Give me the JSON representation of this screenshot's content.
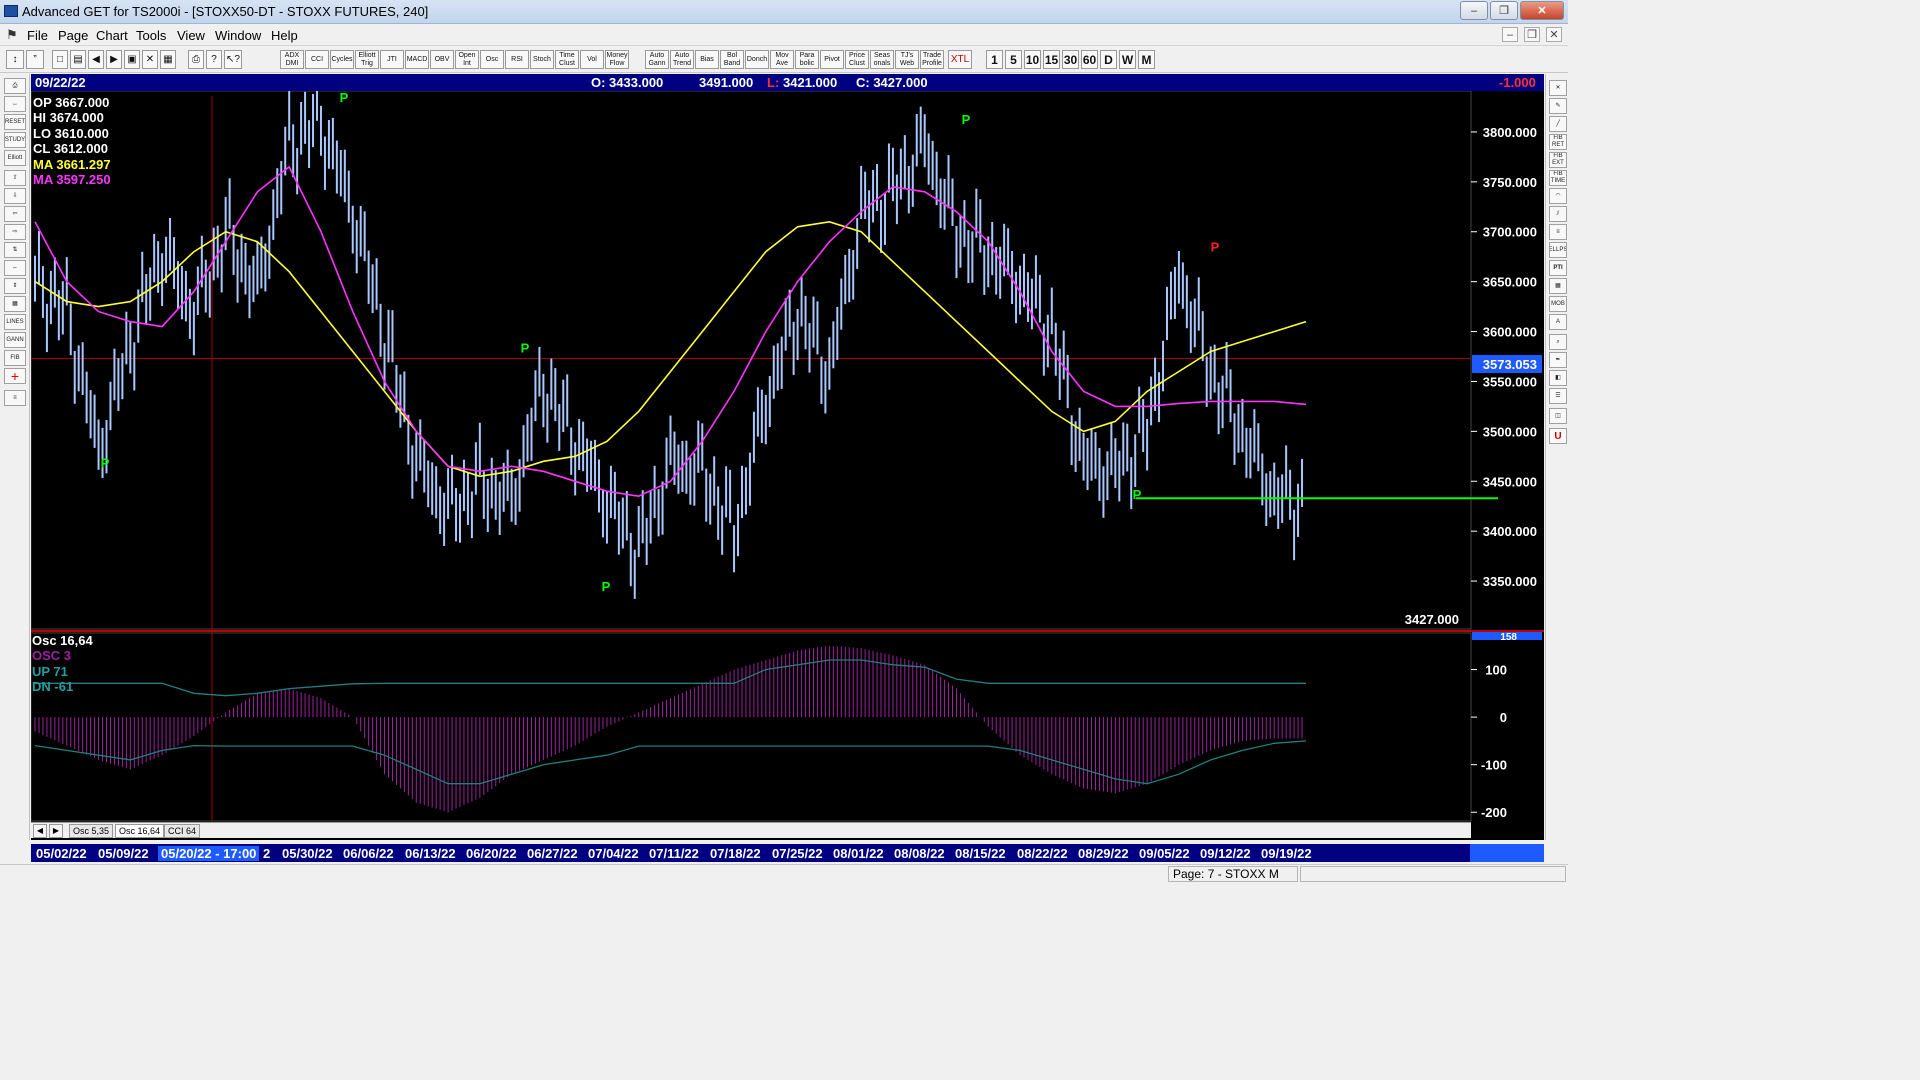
{
  "window": {
    "title": "Advanced GET for TS2000i - [STOXX50-DT - STOXX FUTURES, 240]"
  },
  "menu": [
    "File",
    "Page",
    "Chart",
    "Tools",
    "View",
    "Window",
    "Help"
  ],
  "toolbar": {
    "indicators": [
      "ADX DMI",
      "CCI",
      "Cycles",
      "Elliott Trig",
      "JTI",
      "MACD",
      "OBV",
      "Open Int",
      "Osc",
      "RSI",
      "Stoch",
      "Time Clust",
      "Vol",
      "Money Flow",
      "Auto Gann",
      "Auto Trend",
      "Bias",
      "Bol Band",
      "Donch",
      "Mov Ave",
      "Para bolic",
      "Pivot",
      "Price Clust",
      "Seas onals",
      "TJ's Web",
      "Trade Profile",
      "XTL"
    ],
    "timeframes": [
      "1",
      "5",
      "10",
      "15",
      "30",
      "60",
      "D",
      "W",
      "M"
    ]
  },
  "left_tools": [
    "RESET",
    "STUDY",
    "Elliott",
    "LINES",
    "GANN",
    "FIB"
  ],
  "right_tools": [
    "FIB RET",
    "FIB EXT",
    "FIB TIME",
    "ELLPS",
    "PTI",
    "MOB"
  ],
  "header": {
    "date": "09/22/22",
    "open": "O: 3433.000",
    "high": "3491.000",
    "low_label": "L:",
    "low": "3421.000",
    "close": "C: 3427.000",
    "change": "-1.000"
  },
  "legend": {
    "op": "OP  3667.000",
    "hi": "HI   3674.000",
    "lo": "LO  3610.000",
    "cl": "CL  3612.000",
    "ma1": "MA  3661.297",
    "ma2": "MA  3597.250",
    "ma1_color": "#ffff33",
    "ma2_color": "#ff33ff"
  },
  "price_axis": {
    "ticks": [
      "3800.000",
      "3750.000",
      "3700.000",
      "3650.000",
      "3600.000",
      "3550.000",
      "3500.000",
      "3450.000",
      "3400.000",
      "3350.000"
    ],
    "marker": "3573.053",
    "last": "3427.000"
  },
  "pivot_label": "P",
  "osc": {
    "title": "Osc 16,64",
    "osc3": "OSC 3",
    "up": "UP  71",
    "dn": "DN  -61",
    "ticks": [
      "100",
      "0",
      "-100",
      "-200"
    ],
    "top_marker": "158"
  },
  "tabs": [
    "Osc 5,35",
    "Osc 16,64",
    "CCI 64"
  ],
  "dates": [
    "05/02/22",
    "05/09/22",
    "05/20/22 - 17:00",
    "2",
    "05/30/22",
    "06/06/22",
    "06/13/22",
    "06/20/22",
    "06/27/22",
    "07/04/22",
    "07/11/22",
    "07/18/22",
    "07/25/22",
    "08/01/22",
    "08/08/22",
    "08/15/22",
    "08/22/22",
    "08/29/22",
    "09/05/22",
    "09/12/22",
    "09/19/22"
  ],
  "status": "Page: 7 - STOXX M",
  "colors": {
    "bg": "#000000",
    "bar": "#a8c8ff",
    "fast_ma": "#ffff33",
    "slow_ma": "#ff33ff",
    "support": "#00ff00",
    "hline": "#aa0000",
    "pivot_green": "#00ff00",
    "pivot_red": "#ff2020",
    "osc_hist": "#a020a0",
    "osc_line": "#208080",
    "axis_bar": "#000080"
  },
  "chart_data": {
    "type": "line",
    "title": "STOXX50-DT - STOXX FUTURES, 240",
    "xlabel": "",
    "ylabel": "",
    "ylim": [
      3310,
      3835
    ],
    "series": [
      {
        "name": "Price",
        "values": [
          3650,
          3620,
          3480,
          3590,
          3680,
          3620,
          3700,
          3640,
          3790,
          3810,
          3720,
          3600,
          3470,
          3420,
          3450,
          3430,
          3550,
          3490,
          3430,
          3380,
          3470,
          3460,
          3400,
          3530,
          3620,
          3560,
          3720,
          3740,
          3790,
          3700,
          3680,
          3650,
          3600,
          3470,
          3460,
          3500,
          3660,
          3560,
          3500,
          3435,
          3427
        ]
      },
      {
        "name": "MA",
        "values": [
          3650,
          3630,
          3625,
          3630,
          3650,
          3680,
          3700,
          3690,
          3660,
          3620,
          3580,
          3540,
          3500,
          3465,
          3455,
          3460,
          3470,
          3475,
          3490,
          3520,
          3560,
          3600,
          3640,
          3680,
          3705,
          3710,
          3700,
          3670,
          3640,
          3610,
          3580,
          3550,
          3520,
          3500,
          3510,
          3540,
          3560,
          3580,
          3590,
          3600,
          3610
        ]
      },
      {
        "name": "MA",
        "values": [
          3710,
          3650,
          3620,
          3610,
          3605,
          3640,
          3690,
          3740,
          3765,
          3700,
          3620,
          3550,
          3500,
          3465,
          3460,
          3465,
          3460,
          3450,
          3440,
          3435,
          3450,
          3490,
          3540,
          3600,
          3650,
          3690,
          3720,
          3745,
          3740,
          3720,
          3690,
          3640,
          3580,
          3540,
          3525,
          3525,
          3528,
          3530,
          3530,
          3530,
          3527
        ]
      }
    ],
    "support_level": 3433,
    "hline_level": 3573.053,
    "pivots": [
      {
        "date": "05/09/22",
        "price": 3464,
        "color": "green"
      },
      {
        "date": "05/30/22",
        "price": 3830,
        "color": "green"
      },
      {
        "date": "06/27/22",
        "price": 3579,
        "color": "green"
      },
      {
        "date": "07/04/22",
        "price": 3340,
        "color": "green"
      },
      {
        "date": "08/15/22",
        "price": 3808,
        "color": "green"
      },
      {
        "date": "09/05/22",
        "price": 3432,
        "color": "green"
      },
      {
        "date": "09/12/22",
        "price": 3680,
        "color": "red"
      }
    ],
    "oscillator": {
      "ylim": [
        -210,
        160
      ],
      "hist": [
        -30,
        -60,
        -90,
        -110,
        -80,
        -40,
        10,
        50,
        60,
        40,
        0,
        -120,
        -180,
        -200,
        -170,
        -120,
        -90,
        -60,
        -20,
        10,
        40,
        70,
        100,
        120,
        140,
        150,
        145,
        130,
        110,
        60,
        -20,
        -80,
        -120,
        -150,
        -160,
        -140,
        -100,
        -70,
        -50,
        -45,
        -45
      ],
      "up": [
        71,
        71,
        71,
        71,
        71,
        50,
        45,
        50,
        60,
        65,
        70,
        71,
        71,
        71,
        71,
        71,
        71,
        71,
        71,
        71,
        71,
        71,
        71,
        100,
        110,
        120,
        120,
        110,
        105,
        80,
        71,
        71,
        71,
        71,
        71,
        71,
        71,
        71,
        71,
        71,
        71
      ],
      "dn": [
        -60,
        -70,
        -80,
        -90,
        -70,
        -60,
        -61,
        -61,
        -61,
        -61,
        -61,
        -80,
        -110,
        -140,
        -140,
        -120,
        -100,
        -90,
        -80,
        -61,
        -61,
        -61,
        -61,
        -61,
        -61,
        -61,
        -61,
        -61,
        -61,
        -61,
        -61,
        -70,
        -90,
        -110,
        -130,
        -140,
        -120,
        -90,
        -70,
        -55,
        -50
      ]
    }
  }
}
